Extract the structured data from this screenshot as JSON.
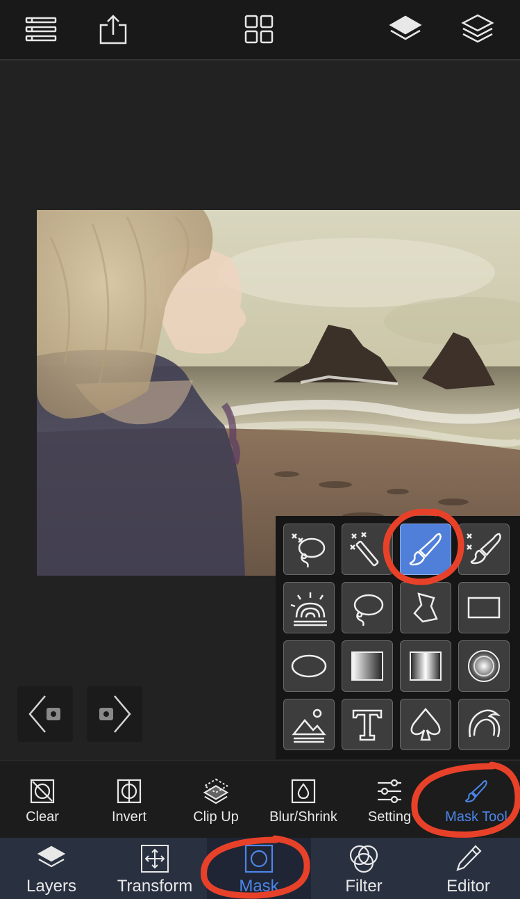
{
  "topbar": {
    "icons": [
      "list-icon",
      "share-icon",
      "grid-icon",
      "layers-single-icon",
      "layers-stack-icon"
    ]
  },
  "tool_panel": {
    "selected_tool": "brush",
    "tools": [
      "auto-lasso",
      "magic-wand",
      "brush",
      "auto-brush",
      "sunrise",
      "lasso",
      "polygon-lasso",
      "rectangle",
      "ellipse",
      "linear-gradient",
      "mirrored-gradient",
      "radial-gradient",
      "landscape",
      "text",
      "spade-shape",
      "hair"
    ]
  },
  "mask_toolbar": {
    "clear": "Clear",
    "invert": "Invert",
    "clip_up": "Clip Up",
    "blur_shrink": "Blur/Shrink",
    "setting": "Setting",
    "mask_tool": "Mask Tool"
  },
  "bottom_tabs": {
    "layers": "Layers",
    "transform": "Transform",
    "mask": "Mask",
    "filter": "Filter",
    "editor": "Editor"
  },
  "colors": {
    "accent": "#4c86e8",
    "annotation": "#e8412a",
    "tab_bar": "#293040"
  }
}
